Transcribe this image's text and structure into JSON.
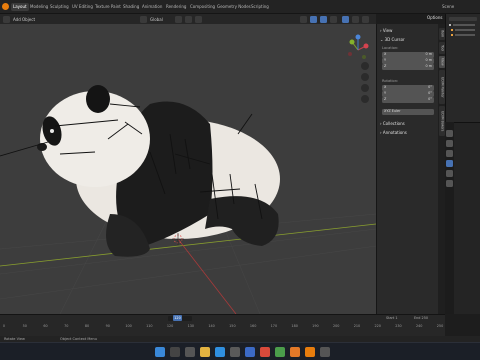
{
  "menu": {
    "workspaces": [
      "Layout",
      "Modeling",
      "Sculpting",
      "UV Editing",
      "Texture Paint",
      "Shading",
      "Animation",
      "Rendering",
      "Compositing",
      "Geometry Nodes",
      "Scripting"
    ],
    "active_workspace": "Layout",
    "scene_label": "Scene"
  },
  "viewport_header": {
    "add_label": "Add",
    "object_label": "Object",
    "orientation": "Global",
    "options_label": "Options"
  },
  "npanel": {
    "view_header": "View",
    "cursor_header": "3D Cursor",
    "location_label": "Location:",
    "loc": [
      {
        "axis": "X",
        "value": "0 m"
      },
      {
        "axis": "Y",
        "value": "0 m"
      },
      {
        "axis": "Z",
        "value": "0 m"
      }
    ],
    "rotation_label": "Rotation:",
    "rot": [
      {
        "axis": "X",
        "value": "0°"
      },
      {
        "axis": "Y",
        "value": "0°"
      },
      {
        "axis": "Z",
        "value": "0°"
      }
    ],
    "rotation_mode": "XYZ Euler",
    "collections_header": "Collections",
    "annotations_header": "Annotations",
    "side_tabs": [
      "Item",
      "Tool",
      "View",
      "UDIM Painter",
      "UDIM Bakers"
    ]
  },
  "timeline": {
    "ticks": [
      "0",
      "50",
      "60",
      "70",
      "80",
      "90",
      "100",
      "110",
      "120",
      "130",
      "140",
      "150",
      "160",
      "170",
      "180",
      "190",
      "200",
      "210",
      "220",
      "230",
      "240",
      "250"
    ],
    "current_frame": "120",
    "start_label": "Start",
    "start_value": "1",
    "end_label": "End",
    "end_value": "250"
  },
  "status": {
    "left": "Rotate View",
    "mid": "Object Context Menu"
  },
  "colors": {
    "accent": "#4772b3",
    "orange": "#e87d0d",
    "grid_x": "#a83a3a",
    "grid_y": "#8aa02e"
  },
  "icons": [
    "blender-logo",
    "search-icon",
    "windows-start-icon",
    "file-explorer-icon",
    "browser-icon",
    "blender-taskbar-icon"
  ]
}
